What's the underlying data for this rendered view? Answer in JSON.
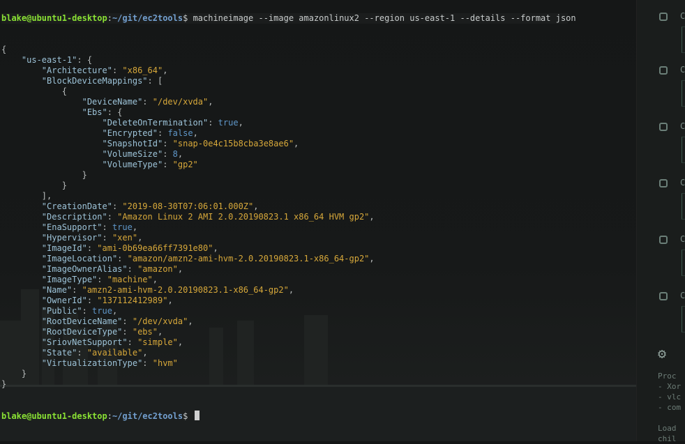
{
  "prompt": {
    "user_host": "blake@ubuntu1-desktop",
    "sep": ":",
    "path": "~/git/ec2tools",
    "symbol": "$ "
  },
  "command": "machineimage --image amazonlinux2 --region us-east-1 --details --format json",
  "json_lines": [
    [
      [
        "p",
        "{"
      ]
    ],
    [
      [
        "p",
        "    "
      ],
      [
        "k",
        "\"us-east-1\""
      ],
      [
        "p",
        ": {"
      ]
    ],
    [
      [
        "p",
        "        "
      ],
      [
        "k",
        "\"Architecture\""
      ],
      [
        "p",
        ": "
      ],
      [
        "s",
        "\"x86_64\""
      ],
      [
        "p",
        ","
      ]
    ],
    [
      [
        "p",
        "        "
      ],
      [
        "k",
        "\"BlockDeviceMappings\""
      ],
      [
        "p",
        ": ["
      ]
    ],
    [
      [
        "p",
        "            {"
      ]
    ],
    [
      [
        "p",
        "                "
      ],
      [
        "k",
        "\"DeviceName\""
      ],
      [
        "p",
        ": "
      ],
      [
        "s",
        "\"/dev/xvda\""
      ],
      [
        "p",
        ","
      ]
    ],
    [
      [
        "p",
        "                "
      ],
      [
        "k",
        "\"Ebs\""
      ],
      [
        "p",
        ": {"
      ]
    ],
    [
      [
        "p",
        "                    "
      ],
      [
        "k",
        "\"DeleteOnTermination\""
      ],
      [
        "p",
        ": "
      ],
      [
        "b",
        "true"
      ],
      [
        "p",
        ","
      ]
    ],
    [
      [
        "p",
        "                    "
      ],
      [
        "k",
        "\"Encrypted\""
      ],
      [
        "p",
        ": "
      ],
      [
        "b",
        "false"
      ],
      [
        "p",
        ","
      ]
    ],
    [
      [
        "p",
        "                    "
      ],
      [
        "k",
        "\"SnapshotId\""
      ],
      [
        "p",
        ": "
      ],
      [
        "s",
        "\"snap-0e4c15b8cba3e8ae6\""
      ],
      [
        "p",
        ","
      ]
    ],
    [
      [
        "p",
        "                    "
      ],
      [
        "k",
        "\"VolumeSize\""
      ],
      [
        "p",
        ": "
      ],
      [
        "n",
        "8"
      ],
      [
        "p",
        ","
      ]
    ],
    [
      [
        "p",
        "                    "
      ],
      [
        "k",
        "\"VolumeType\""
      ],
      [
        "p",
        ": "
      ],
      [
        "s",
        "\"gp2\""
      ]
    ],
    [
      [
        "p",
        "                }"
      ]
    ],
    [
      [
        "p",
        "            }"
      ]
    ],
    [
      [
        "p",
        "        ],"
      ]
    ],
    [
      [
        "p",
        "        "
      ],
      [
        "k",
        "\"CreationDate\""
      ],
      [
        "p",
        ": "
      ],
      [
        "s",
        "\"2019-08-30T07:06:01.000Z\""
      ],
      [
        "p",
        ","
      ]
    ],
    [
      [
        "p",
        "        "
      ],
      [
        "k",
        "\"Description\""
      ],
      [
        "p",
        ": "
      ],
      [
        "s",
        "\"Amazon Linux 2 AMI 2.0.20190823.1 x86_64 HVM gp2\""
      ],
      [
        "p",
        ","
      ]
    ],
    [
      [
        "p",
        "        "
      ],
      [
        "k",
        "\"EnaSupport\""
      ],
      [
        "p",
        ": "
      ],
      [
        "b",
        "true"
      ],
      [
        "p",
        ","
      ]
    ],
    [
      [
        "p",
        "        "
      ],
      [
        "k",
        "\"Hypervisor\""
      ],
      [
        "p",
        ": "
      ],
      [
        "s",
        "\"xen\""
      ],
      [
        "p",
        ","
      ]
    ],
    [
      [
        "p",
        "        "
      ],
      [
        "k",
        "\"ImageId\""
      ],
      [
        "p",
        ": "
      ],
      [
        "s",
        "\"ami-0b69ea66ff7391e80\""
      ],
      [
        "p",
        ","
      ]
    ],
    [
      [
        "p",
        "        "
      ],
      [
        "k",
        "\"ImageLocation\""
      ],
      [
        "p",
        ": "
      ],
      [
        "s",
        "\"amazon/amzn2-ami-hvm-2.0.20190823.1-x86_64-gp2\""
      ],
      [
        "p",
        ","
      ]
    ],
    [
      [
        "p",
        "        "
      ],
      [
        "k",
        "\"ImageOwnerAlias\""
      ],
      [
        "p",
        ": "
      ],
      [
        "s",
        "\"amazon\""
      ],
      [
        "p",
        ","
      ]
    ],
    [
      [
        "p",
        "        "
      ],
      [
        "k",
        "\"ImageType\""
      ],
      [
        "p",
        ": "
      ],
      [
        "s",
        "\"machine\""
      ],
      [
        "p",
        ","
      ]
    ],
    [
      [
        "p",
        "        "
      ],
      [
        "k",
        "\"Name\""
      ],
      [
        "p",
        ": "
      ],
      [
        "s",
        "\"amzn2-ami-hvm-2.0.20190823.1-x86_64-gp2\""
      ],
      [
        "p",
        ","
      ]
    ],
    [
      [
        "p",
        "        "
      ],
      [
        "k",
        "\"OwnerId\""
      ],
      [
        "p",
        ": "
      ],
      [
        "s",
        "\"137112412989\""
      ],
      [
        "p",
        ","
      ]
    ],
    [
      [
        "p",
        "        "
      ],
      [
        "k",
        "\"Public\""
      ],
      [
        "p",
        ": "
      ],
      [
        "b",
        "true"
      ],
      [
        "p",
        ","
      ]
    ],
    [
      [
        "p",
        "        "
      ],
      [
        "k",
        "\"RootDeviceName\""
      ],
      [
        "p",
        ": "
      ],
      [
        "s",
        "\"/dev/xvda\""
      ],
      [
        "p",
        ","
      ]
    ],
    [
      [
        "p",
        "        "
      ],
      [
        "k",
        "\"RootDeviceType\""
      ],
      [
        "p",
        ": "
      ],
      [
        "s",
        "\"ebs\""
      ],
      [
        "p",
        ","
      ]
    ],
    [
      [
        "p",
        "        "
      ],
      [
        "k",
        "\"SriovNetSupport\""
      ],
      [
        "p",
        ": "
      ],
      [
        "s",
        "\"simple\""
      ],
      [
        "p",
        ","
      ]
    ],
    [
      [
        "p",
        "        "
      ],
      [
        "k",
        "\"State\""
      ],
      [
        "p",
        ": "
      ],
      [
        "s",
        "\"available\""
      ],
      [
        "p",
        ","
      ]
    ],
    [
      [
        "p",
        "        "
      ],
      [
        "k",
        "\"VirtualizationType\""
      ],
      [
        "p",
        ": "
      ],
      [
        "s",
        "\"hvm\""
      ]
    ],
    [
      [
        "p",
        "    }"
      ]
    ],
    [
      [
        "p",
        "}"
      ]
    ]
  ],
  "side_panel": {
    "letters": [
      "C",
      "C",
      "C",
      "C",
      "C",
      "C"
    ],
    "bottom_lines": [
      "Proc",
      "- Xor",
      "- vlc",
      "- com",
      "",
      "Load",
      "chil"
    ]
  },
  "colors": {
    "background": "#141616",
    "user": "#8ae234",
    "path": "#729fcf",
    "key": "#9dc3d8",
    "string": "#d7a83a",
    "number": "#5f97c9"
  }
}
